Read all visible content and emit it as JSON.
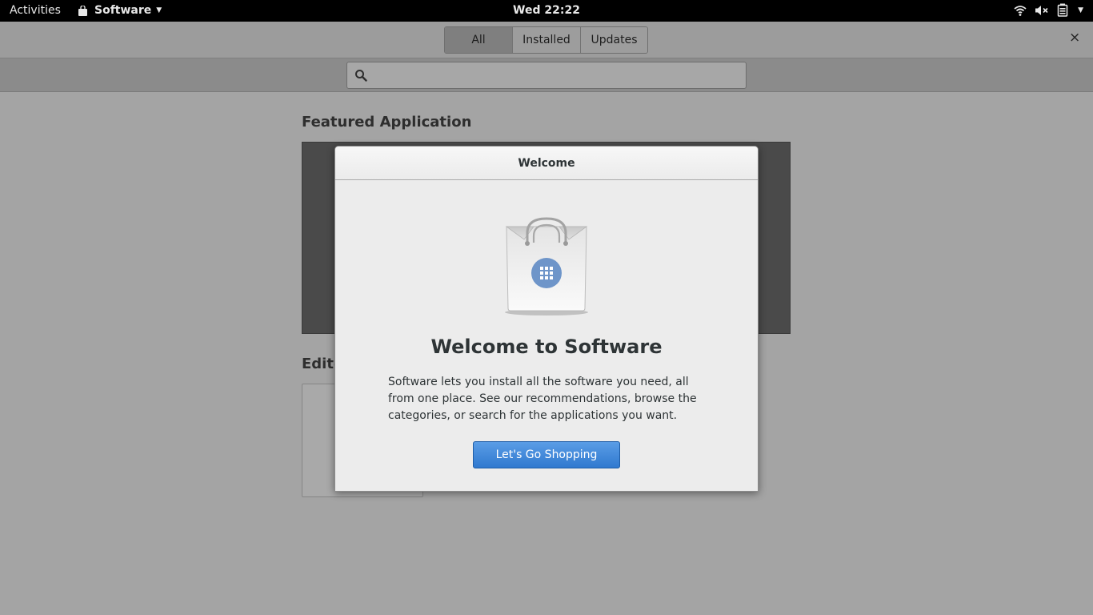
{
  "topbar": {
    "activities": "Activities",
    "app_menu": "Software",
    "clock": "Wed 22:22",
    "icons": [
      "wifi-icon",
      "volume-muted-icon",
      "battery-icon",
      "menu-arrow-icon"
    ]
  },
  "header": {
    "tabs": [
      {
        "label": "All",
        "active": true
      },
      {
        "label": "Installed",
        "active": false
      },
      {
        "label": "Updates",
        "active": false
      }
    ],
    "close_label": "×"
  },
  "search": {
    "value": "",
    "placeholder": ""
  },
  "main": {
    "featured_title": "Featured Application",
    "editor_title": "Editor's Picks"
  },
  "dialog": {
    "title": "Welcome",
    "heading": "Welcome to Software",
    "body": "Software lets you install all the software you need, all from one place. See our recommendations, browse the categories, or search for the applications you want.",
    "button": "Let's Go Shopping"
  },
  "colors": {
    "accent": "#3d85d8",
    "topbar": "#000000",
    "backdrop": "#a4a4a4"
  }
}
